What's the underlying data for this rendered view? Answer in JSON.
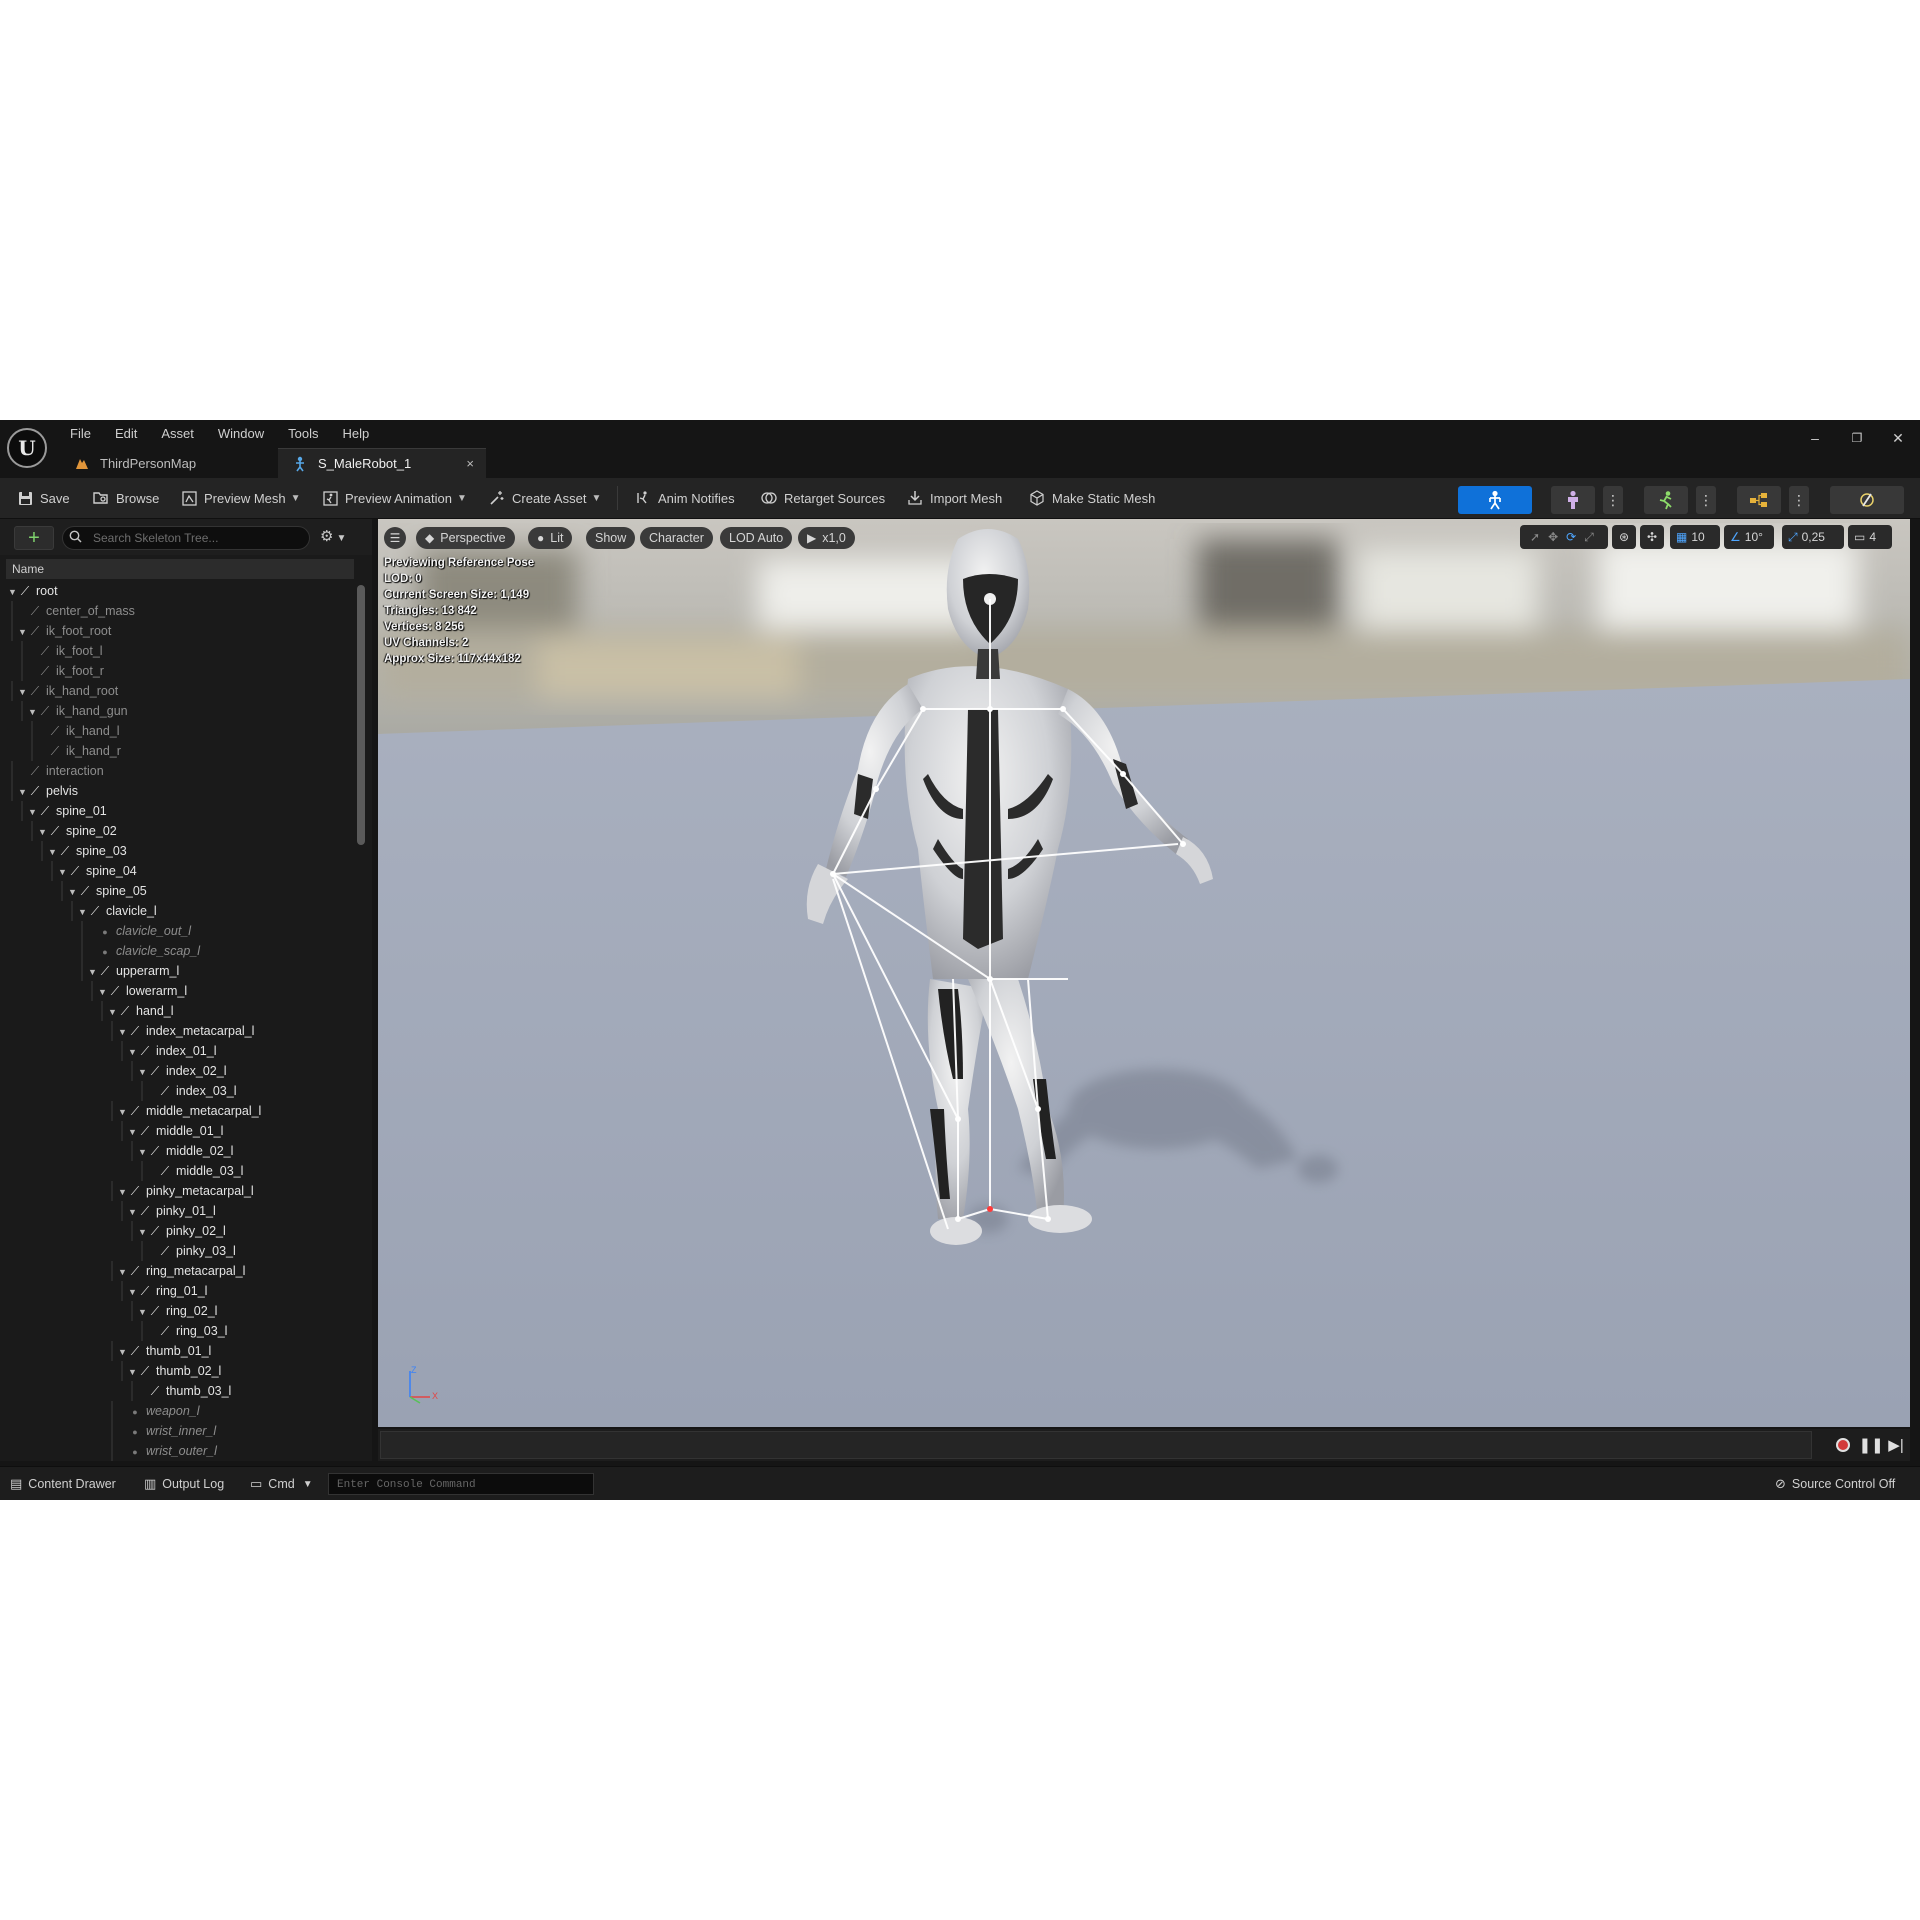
{
  "menu": [
    "File",
    "Edit",
    "Asset",
    "Window",
    "Tools",
    "Help"
  ],
  "tabs": [
    {
      "label": "ThirdPersonMap",
      "icon": "level-icon"
    },
    {
      "label": "S_MaleRobot_1",
      "icon": "skeleton-icon",
      "close": "×"
    }
  ],
  "window_controls": {
    "minimize": "–",
    "restore": "❐",
    "close": "✕"
  },
  "toolbar": {
    "save": "Save",
    "browse": "Browse",
    "preview_mesh": "Preview Mesh",
    "preview_animation": "Preview Animation",
    "create_asset": "Create Asset",
    "anim_notifies": "Anim Notifies",
    "retarget_sources": "Retarget Sources",
    "import_mesh": "Import Mesh",
    "make_static_mesh": "Make Static Mesh"
  },
  "skeleton_tree": {
    "search_placeholder": "Search Skeleton Tree...",
    "column_name": "Name",
    "bones": [
      {
        "name": "root",
        "depth": 0,
        "style": "bright",
        "arrow": true
      },
      {
        "name": "center_of_mass",
        "depth": 1,
        "style": "dim",
        "arrow": false
      },
      {
        "name": "ik_foot_root",
        "depth": 1,
        "style": "dim",
        "arrow": true
      },
      {
        "name": "ik_foot_l",
        "depth": 2,
        "style": "dim",
        "arrow": false
      },
      {
        "name": "ik_foot_r",
        "depth": 2,
        "style": "dim",
        "arrow": false
      },
      {
        "name": "ik_hand_root",
        "depth": 1,
        "style": "dim",
        "arrow": true
      },
      {
        "name": "ik_hand_gun",
        "depth": 2,
        "style": "dim",
        "arrow": true
      },
      {
        "name": "ik_hand_l",
        "depth": 3,
        "style": "dim",
        "arrow": false
      },
      {
        "name": "ik_hand_r",
        "depth": 3,
        "style": "dim",
        "arrow": false
      },
      {
        "name": "interaction",
        "depth": 1,
        "style": "dim",
        "arrow": false
      },
      {
        "name": "pelvis",
        "depth": 1,
        "style": "bright",
        "arrow": true
      },
      {
        "name": "spine_01",
        "depth": 2,
        "style": "bright",
        "arrow": true
      },
      {
        "name": "spine_02",
        "depth": 3,
        "style": "bright",
        "arrow": true
      },
      {
        "name": "spine_03",
        "depth": 4,
        "style": "bright",
        "arrow": true
      },
      {
        "name": "spine_04",
        "depth": 5,
        "style": "bright",
        "arrow": true
      },
      {
        "name": "spine_05",
        "depth": 6,
        "style": "bright",
        "arrow": true
      },
      {
        "name": "clavicle_l",
        "depth": 7,
        "style": "bright",
        "arrow": true
      },
      {
        "name": "clavicle_out_l",
        "depth": 8,
        "style": "italic",
        "arrow": false
      },
      {
        "name": "clavicle_scap_l",
        "depth": 8,
        "style": "italic",
        "arrow": false
      },
      {
        "name": "upperarm_l",
        "depth": 8,
        "style": "bright",
        "arrow": true
      },
      {
        "name": "lowerarm_l",
        "depth": 9,
        "style": "bright",
        "arrow": true
      },
      {
        "name": "hand_l",
        "depth": 10,
        "style": "bright",
        "arrow": true
      },
      {
        "name": "index_metacarpal_l",
        "depth": 11,
        "style": "bright",
        "arrow": true
      },
      {
        "name": "index_01_l",
        "depth": 12,
        "style": "bright",
        "arrow": true
      },
      {
        "name": "index_02_l",
        "depth": 13,
        "style": "bright",
        "arrow": true
      },
      {
        "name": "index_03_l",
        "depth": 14,
        "style": "bright",
        "arrow": false
      },
      {
        "name": "middle_metacarpal_l",
        "depth": 11,
        "style": "bright",
        "arrow": true
      },
      {
        "name": "middle_01_l",
        "depth": 12,
        "style": "bright",
        "arrow": true
      },
      {
        "name": "middle_02_l",
        "depth": 13,
        "style": "bright",
        "arrow": true
      },
      {
        "name": "middle_03_l",
        "depth": 14,
        "style": "bright",
        "arrow": false
      },
      {
        "name": "pinky_metacarpal_l",
        "depth": 11,
        "style": "bright",
        "arrow": true
      },
      {
        "name": "pinky_01_l",
        "depth": 12,
        "style": "bright",
        "arrow": true
      },
      {
        "name": "pinky_02_l",
        "depth": 13,
        "style": "bright",
        "arrow": true
      },
      {
        "name": "pinky_03_l",
        "depth": 14,
        "style": "bright",
        "arrow": false
      },
      {
        "name": "ring_metacarpal_l",
        "depth": 11,
        "style": "bright",
        "arrow": true
      },
      {
        "name": "ring_01_l",
        "depth": 12,
        "style": "bright",
        "arrow": true
      },
      {
        "name": "ring_02_l",
        "depth": 13,
        "style": "bright",
        "arrow": true
      },
      {
        "name": "ring_03_l",
        "depth": 14,
        "style": "bright",
        "arrow": false
      },
      {
        "name": "thumb_01_l",
        "depth": 11,
        "style": "bright",
        "arrow": true
      },
      {
        "name": "thumb_02_l",
        "depth": 12,
        "style": "bright",
        "arrow": true
      },
      {
        "name": "thumb_03_l",
        "depth": 13,
        "style": "bright",
        "arrow": false
      },
      {
        "name": "weapon_l",
        "depth": 11,
        "style": "italic",
        "arrow": false
      },
      {
        "name": "wrist_inner_l",
        "depth": 11,
        "style": "italic",
        "arrow": false
      },
      {
        "name": "wrist_outer_l",
        "depth": 11,
        "style": "italic",
        "arrow": false
      }
    ]
  },
  "viewport": {
    "view_mode": "Perspective",
    "lighting": "Lit",
    "show": "Show",
    "character": "Character",
    "lod": "LOD Auto",
    "play_rate": "x1,0",
    "stats": [
      "Previewing Reference Pose",
      "LOD: 0",
      "Current Screen Size: 1,149",
      "Triangles: 13 842",
      "Vertices: 8 256",
      "UV Channels: 2",
      "Approx Size: 117x44x182"
    ],
    "grid_snap": "10",
    "rotation_snap": "10°",
    "scale_snap": "0,25",
    "camera_speed": "4",
    "axis": {
      "z": "Z",
      "x": "X"
    }
  },
  "statusbar": {
    "content_drawer": "Content Drawer",
    "output_log": "Output Log",
    "cmd": "Cmd",
    "console_placeholder": "Enter Console Command",
    "source_control": "Source Control Off"
  },
  "colors": {
    "accent": "#0f71d9",
    "record": "#d23a3a",
    "add": "#7fd36e"
  }
}
